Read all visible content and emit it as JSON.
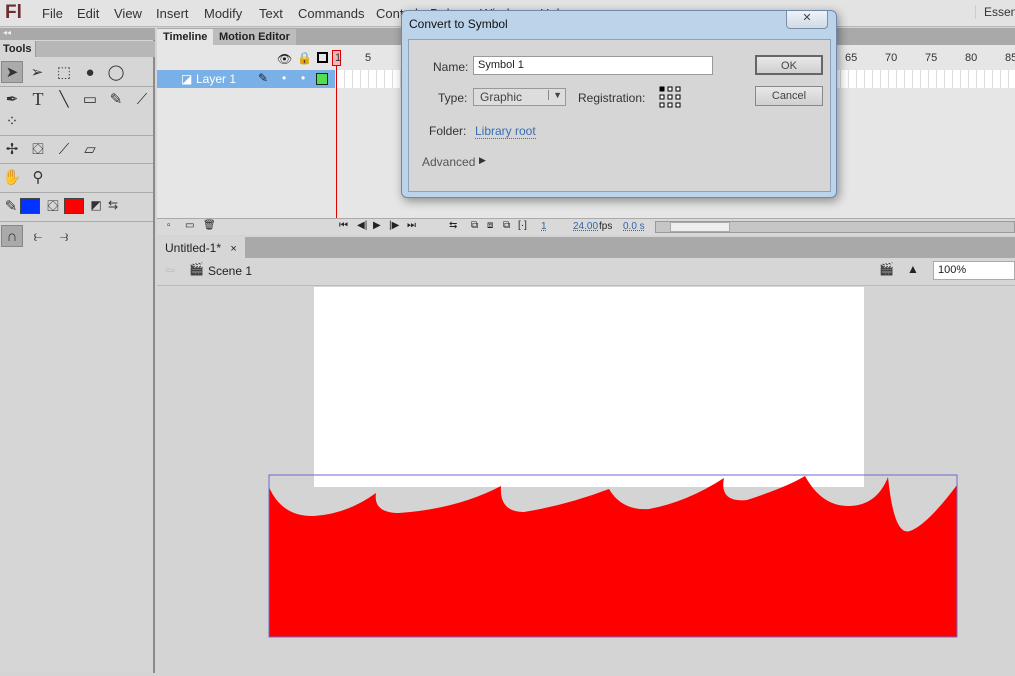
{
  "app": {
    "logo": "Fl",
    "workspace": "Essentials"
  },
  "menu": [
    "File",
    "Edit",
    "View",
    "Insert",
    "Modify",
    "Text",
    "Commands",
    "Control",
    "Debug",
    "Window",
    "Help"
  ],
  "tools": {
    "panel_title": "Tools",
    "stroke_color": "#0033ff",
    "fill_color": "#ff0000"
  },
  "timeline": {
    "tabs": [
      "Timeline",
      "Motion Editor"
    ],
    "layer_name": "Layer 1",
    "frame_numbers": [
      1,
      5,
      65,
      70,
      75,
      80,
      85
    ],
    "current_frame": "1",
    "fps": "24.00",
    "fps_unit": "fps",
    "elapsed": "0.0 s"
  },
  "document": {
    "tab": "Untitled-1*",
    "close": "×",
    "scene": "Scene 1",
    "zoom": "100%"
  },
  "stage": {
    "shape_color": "#ff0000",
    "stage_color": "#ffffff"
  },
  "dialog": {
    "title": "Convert to Symbol",
    "close": "✕",
    "name_label": "Name:",
    "name_value": "Symbol 1",
    "type_label": "Type:",
    "type_value": "Graphic",
    "registration_label": "Registration:",
    "folder_label": "Folder:",
    "folder_value": "Library root",
    "advanced_label": "Advanced",
    "ok": "OK",
    "cancel": "Cancel"
  }
}
